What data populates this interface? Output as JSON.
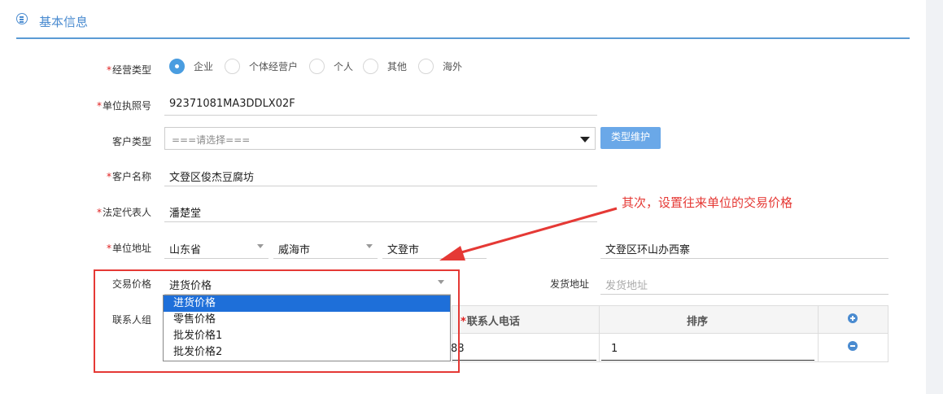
{
  "section": {
    "title": "基本信息"
  },
  "fields": {
    "business_type": {
      "label": "经营类型",
      "required": true,
      "options": [
        "企业",
        "个体经营户",
        "个人",
        "其他",
        "海外"
      ],
      "selected": "企业"
    },
    "license_no": {
      "label": "单位执照号",
      "required": true,
      "value": "92371081MA3DDLX02F"
    },
    "customer_type": {
      "label": "客户类型",
      "value": "===请选择===",
      "button": "类型维护"
    },
    "customer_name": {
      "label": "客户名称",
      "required": true,
      "value": "文登区俊杰豆腐坊"
    },
    "legal_rep": {
      "label": "法定代表人",
      "required": true,
      "value": "潘楚堂"
    },
    "address": {
      "label": "单位地址",
      "required": true,
      "province": "山东省",
      "city": "威海市",
      "district": "文登市",
      "detail": "文登区环山办西寨"
    },
    "trade_price": {
      "label": "交易价格",
      "value": "进货价格",
      "options": [
        "进货价格",
        "零售价格",
        "批发价格1",
        "批发价格2"
      ],
      "highlighted": "进货价格"
    },
    "ship_address": {
      "label": "发货地址",
      "placeholder": "发货地址"
    },
    "contacts": {
      "label": "联系人组",
      "columns": [
        "*联系人电话",
        "排序"
      ],
      "row": {
        "phone_partial": "88",
        "order": "1"
      }
    }
  },
  "annotation": {
    "text": "其次，设置往来单位的交易价格"
  },
  "colors": {
    "accent": "#4a8bd0",
    "annotation": "#e53935",
    "selected_option": "#1e6fd9"
  },
  "icons": [
    "menu-circle-icon",
    "dropdown-caret-icon",
    "add-circle-icon",
    "remove-circle-icon",
    "annotation-arrow"
  ]
}
